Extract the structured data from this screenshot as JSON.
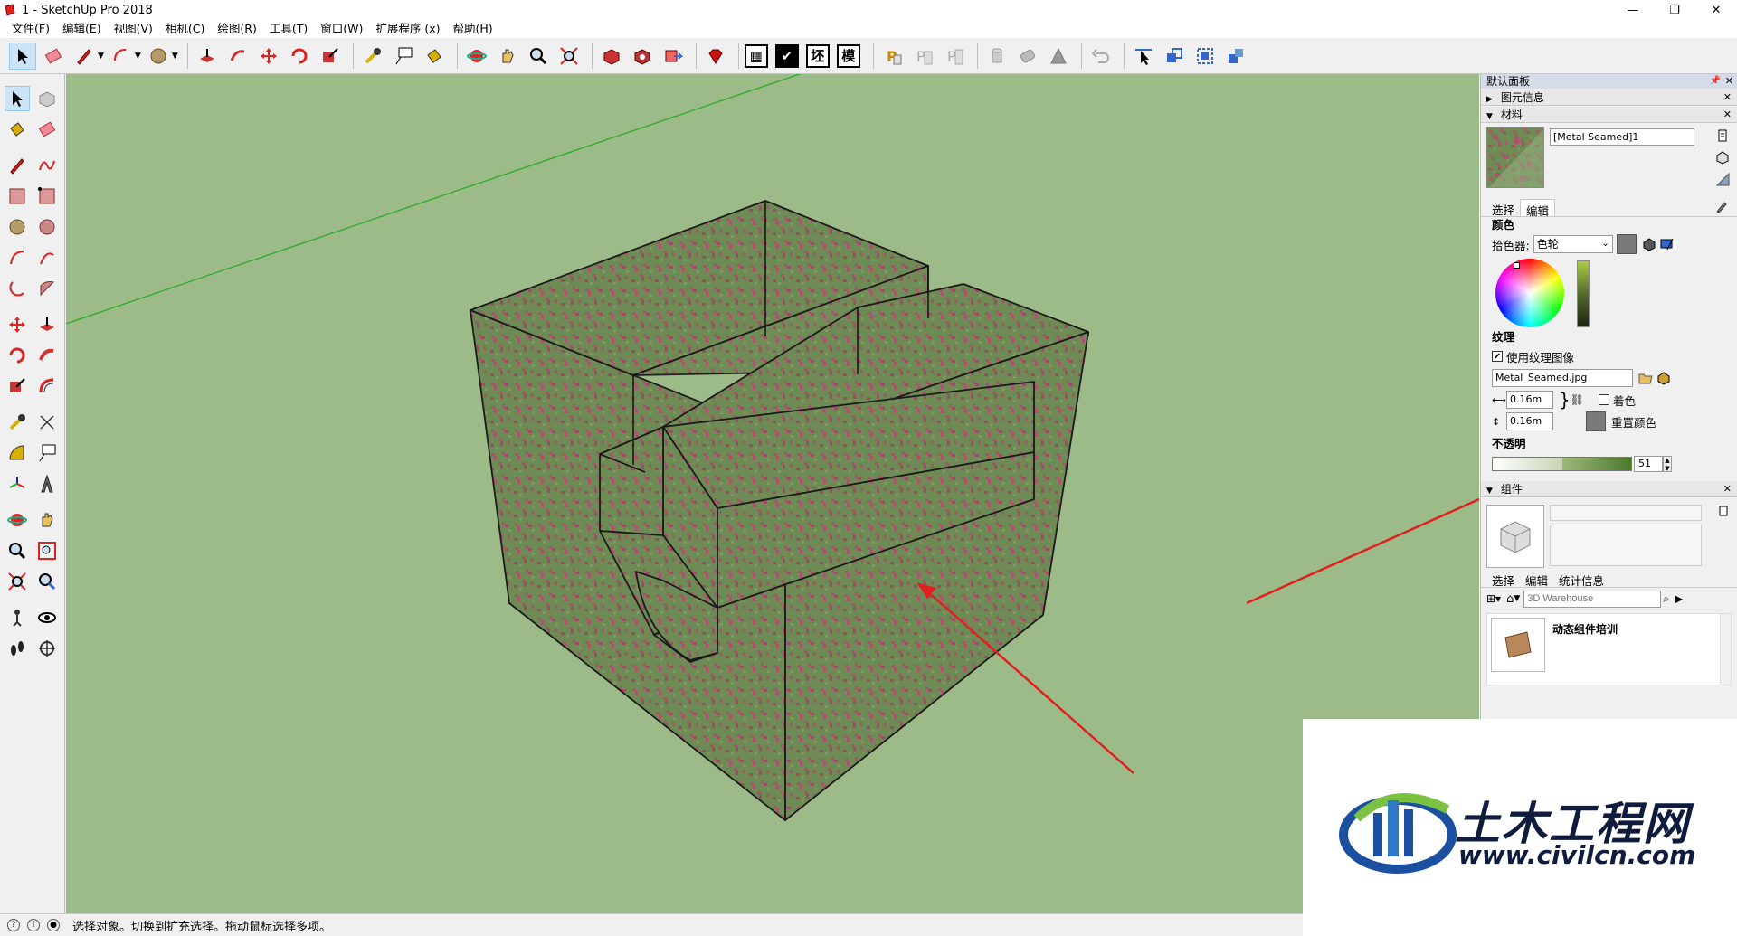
{
  "window": {
    "title": "1 - SketchUp Pro 2018",
    "controls": {
      "minimize": "—",
      "restore": "❐",
      "close": "✕"
    }
  },
  "menu": [
    "文件(F)",
    "编辑(E)",
    "视图(V)",
    "相机(C)",
    "绘图(R)",
    "工具(T)",
    "窗口(W)",
    "扩展程序 (x)",
    "帮助(H)"
  ],
  "toolbar": {
    "text_buttons": [
      "坯",
      "模"
    ]
  },
  "right_panel": {
    "tray_title": "默认面板",
    "entity_info": "图元信息",
    "materials": {
      "header": "材料",
      "name": "[Metal Seamed]1",
      "tabs": [
        "选择",
        "编辑"
      ],
      "active_tab": "编辑",
      "color_group": "颜色",
      "picker_label": "拾色器:",
      "picker_value": "色轮",
      "texture_group": "纹理",
      "use_texture_label": "使用纹理图像",
      "use_texture_checked": true,
      "texture_file": "Metal_Seamed.jpg",
      "width": "0.16m",
      "height": "0.16m",
      "colorize_label": "着色",
      "reset_color_label": "重置颜色",
      "opacity_group": "不透明",
      "opacity_value": "51",
      "swatch_color": "#7a7a7a"
    },
    "components": {
      "header": "组件",
      "tabs": [
        "选择",
        "编辑",
        "统计信息"
      ],
      "search_placeholder": "3D Warehouse",
      "item_label": "动态组件培训"
    }
  },
  "watermark": {
    "title": "土木工程网",
    "url": "www.civilcn.com"
  },
  "status": {
    "text": "选择对象。切换到扩充选择。拖动鼠标选择多项。"
  },
  "colors": {
    "viewport_bg": "#9dbb89",
    "box_face": "#6f8b55",
    "annotation_arrow": "#e02020",
    "green_axis": "#22aa22"
  }
}
